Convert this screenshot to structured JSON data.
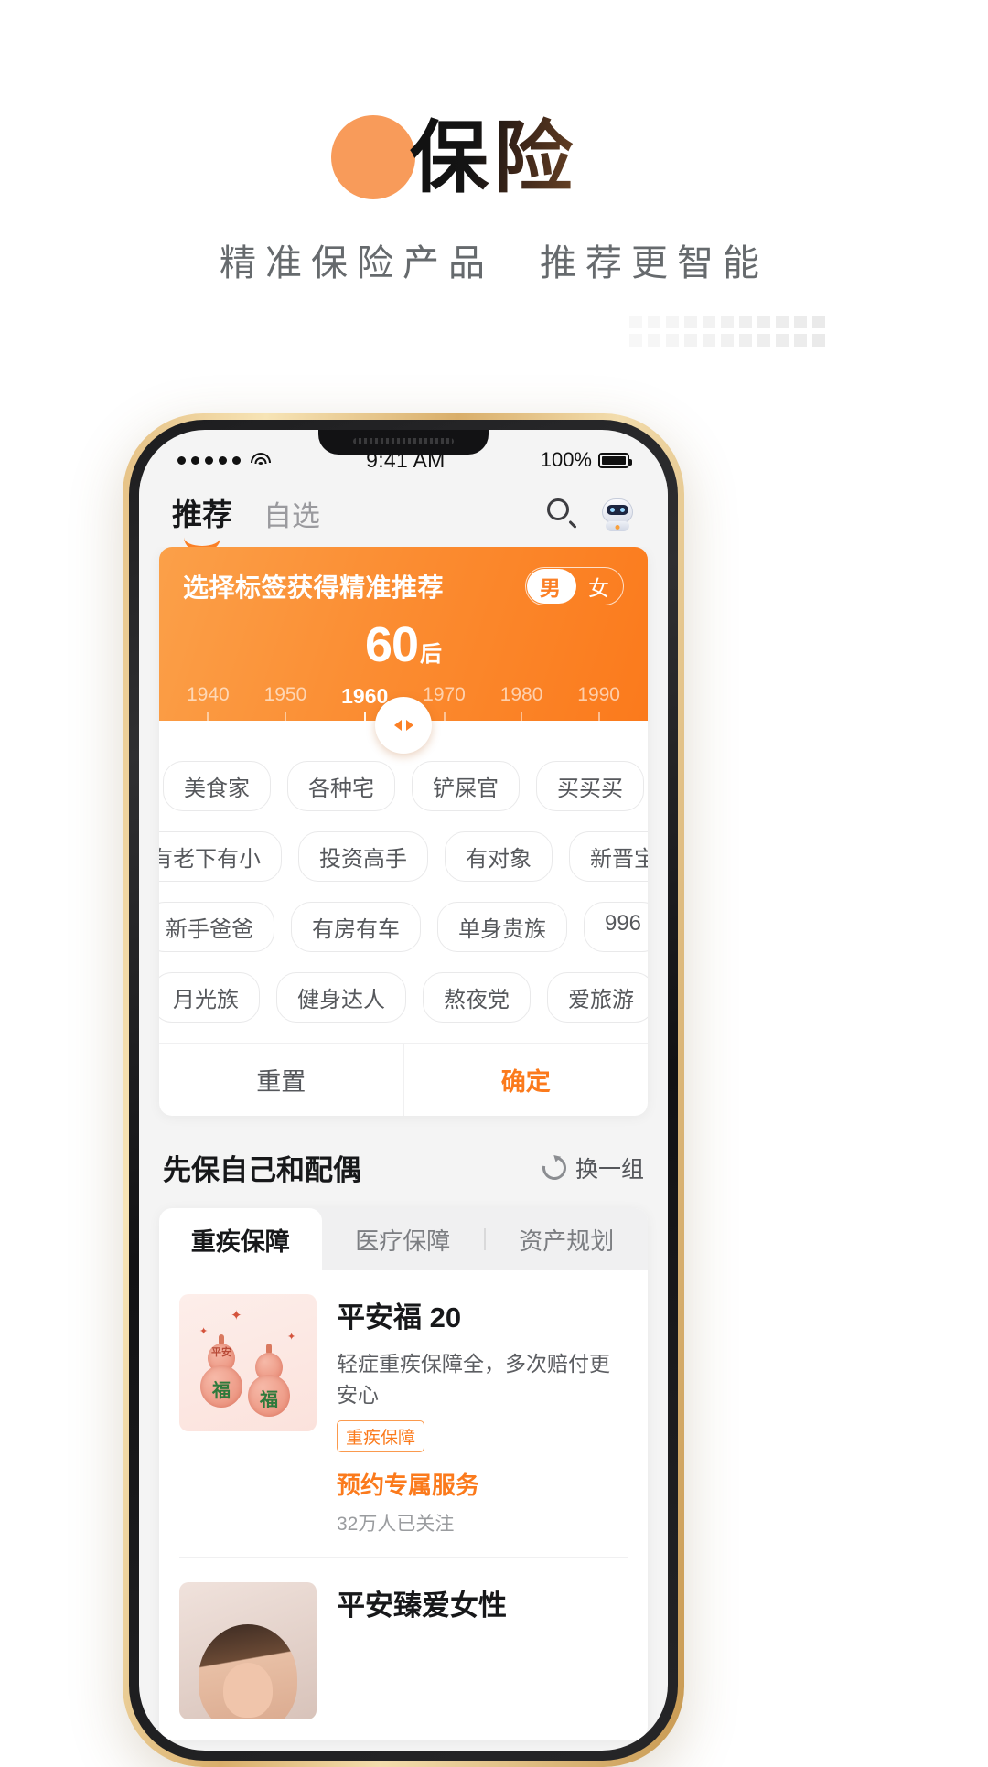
{
  "hero": {
    "title": "保险",
    "subtitle": "精准保险产品　推荐更智能"
  },
  "phone": {
    "status_bar": {
      "signal_icon": "signal-dots-icon",
      "wifi_icon": "wifi-icon",
      "time": "9:41 AM",
      "battery_percent": "100%",
      "battery_icon": "battery-full-icon"
    },
    "navbar": {
      "tabs": [
        {
          "label": "推荐",
          "active": true
        },
        {
          "label": "自选",
          "active": false
        }
      ],
      "search_icon": "search-icon",
      "assistant_icon": "robot-avatar-icon"
    },
    "selector_card": {
      "title": "选择标签获得精准推荐",
      "gender": {
        "options": [
          "男",
          "女"
        ],
        "selected": "男"
      },
      "age_group": {
        "number": "60",
        "suffix": "后"
      },
      "years": [
        "1940",
        "1950",
        "1960",
        "1970",
        "1980",
        "1990"
      ],
      "selected_year": "1960",
      "slider_icon": "slider-handle-icon",
      "tag_rows": [
        [
          "美食家",
          "各种宅",
          "铲屎官",
          "买买买"
        ],
        [
          "上有老下有小",
          "投资高手",
          "有对象",
          "新晋宝妈"
        ],
        [
          "新手爸爸",
          "有房有车",
          "单身贵族",
          "996"
        ],
        [
          "月光族",
          "健身达人",
          "熬夜党",
          "爱旅游"
        ]
      ],
      "reset_label": "重置",
      "confirm_label": "确定"
    },
    "section": {
      "title": "先保自己和配偶",
      "refresh_label": "换一组",
      "refresh_icon": "refresh-icon",
      "tabs": [
        {
          "label": "重疾保障",
          "active": true
        },
        {
          "label": "医疗保障",
          "active": false
        },
        {
          "label": "资产规划",
          "active": false
        }
      ],
      "products": [
        {
          "thumb": "gourd-illustration",
          "thumb_text_top": "平安",
          "thumb_text_bottom": "福",
          "name": "平安福 20",
          "desc": "轻症重疾保障全，多次赔付更安心",
          "badge": "重疾保障",
          "cta": "预约专属服务",
          "stat": "32万人已关注"
        },
        {
          "thumb": "woman-portrait",
          "name": "平安臻爱女性"
        }
      ]
    }
  },
  "colors": {
    "accent": "#FB7A1C",
    "accent_light": "#FBA049",
    "circle": "#F89B5A",
    "text_dark": "#17181a",
    "text_muted": "#9a9c9f"
  }
}
